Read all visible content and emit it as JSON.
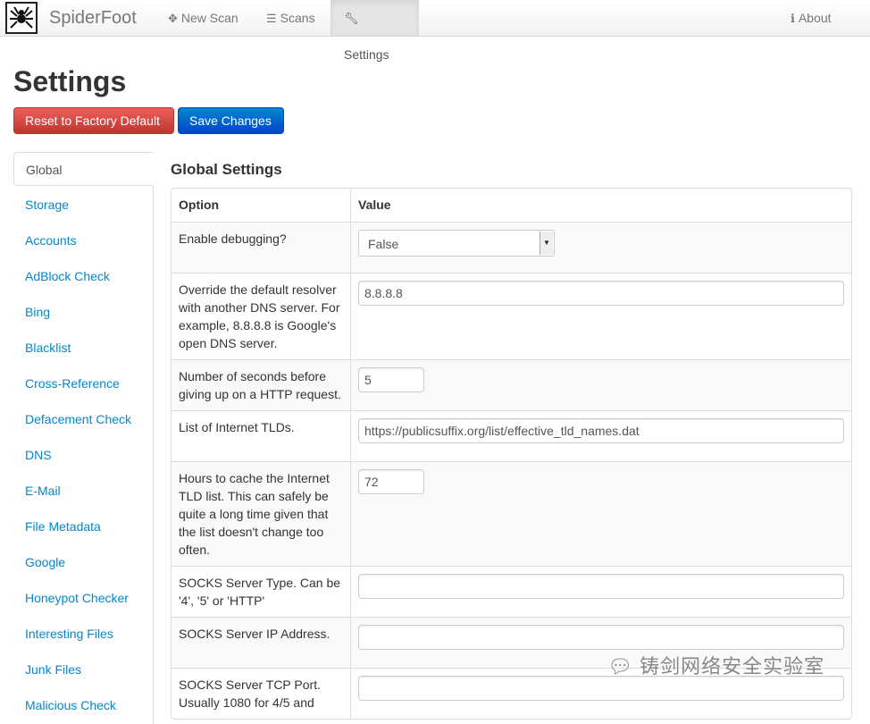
{
  "app": {
    "brand": "SpiderFoot"
  },
  "nav": {
    "new_scan": "New Scan",
    "scans": "Scans",
    "settings": "Settings",
    "about": "About"
  },
  "page": {
    "title": "Settings",
    "reset_button": "Reset to Factory Default",
    "save_button": "Save Changes",
    "section_title": "Global Settings"
  },
  "sidebar": {
    "items": [
      "Global",
      "Storage",
      "Accounts",
      "AdBlock Check",
      "Bing",
      "Blacklist",
      "Cross-Reference",
      "Defacement Check",
      "DNS",
      "E-Mail",
      "File Metadata",
      "Google",
      "Honeypot Checker",
      "Interesting Files",
      "Junk Files",
      "Malicious Check"
    ]
  },
  "table": {
    "headers": {
      "option": "Option",
      "value": "Value"
    },
    "rows": [
      {
        "option": "Enable debugging?",
        "value": "False"
      },
      {
        "option": "Override the default resolver with another DNS server. For example, 8.8.8.8 is Google's open DNS server.",
        "value": "8.8.8.8"
      },
      {
        "option": "Number of seconds before giving up on a HTTP request.",
        "value": "5"
      },
      {
        "option": "List of Internet TLDs.",
        "value": "https://publicsuffix.org/list/effective_tld_names.dat"
      },
      {
        "option": "Hours to cache the Internet TLD list. This can safely be quite a long time given that the list doesn't change too often.",
        "value": "72"
      },
      {
        "option": "SOCKS Server Type. Can be '4', '5' or 'HTTP'",
        "value": ""
      },
      {
        "option": "SOCKS Server IP Address.",
        "value": ""
      },
      {
        "option": "SOCKS Server TCP Port. Usually 1080 for 4/5 and",
        "value": ""
      }
    ]
  },
  "watermark": "铸剑网络安全实验室"
}
